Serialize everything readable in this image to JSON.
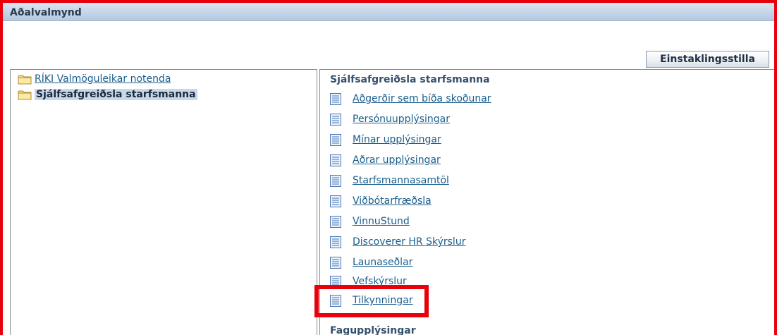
{
  "header": {
    "title": "Aðalvalmynd"
  },
  "toolbar": {
    "personalize_label": "Einstaklingsstilla"
  },
  "tree": {
    "items": [
      {
        "label": "RÍKI Valmöguleikar notenda",
        "selected": false,
        "icon": "folder-icon"
      },
      {
        "label": "Sjálfsafgreiðsla starfsmanna",
        "selected": true,
        "icon": "folder-icon"
      }
    ]
  },
  "functions": {
    "section_title": "Sjálfsafgreiðsla starfsmanna",
    "items": [
      {
        "label": "Aðgerðir sem bíða skoðunar",
        "icon": "document-icon"
      },
      {
        "label": "Persónuupplýsingar",
        "icon": "document-icon"
      },
      {
        "label": "Mínar upplýsingar",
        "icon": "document-icon"
      },
      {
        "label": "Aðrar upplýsingar",
        "icon": "document-icon"
      },
      {
        "label": "Starfsmannasamtöl",
        "icon": "document-icon"
      },
      {
        "label": "Viðbótarfræðsla",
        "icon": "document-icon"
      },
      {
        "label": "VinnuStund",
        "icon": "document-icon"
      },
      {
        "label": "Discoverer HR Skýrslur",
        "icon": "document-icon"
      },
      {
        "label": "Launaseðlar",
        "icon": "document-icon"
      },
      {
        "label": "Vefskýrslur",
        "icon": "document-icon"
      },
      {
        "label": "Tilkynningar",
        "icon": "document-icon"
      }
    ],
    "next_section_title": "Fagupplýsingar"
  },
  "colors": {
    "highlight": "#e8000b",
    "link": "#1a5e8c",
    "header_bg": "#c3d3e8"
  }
}
